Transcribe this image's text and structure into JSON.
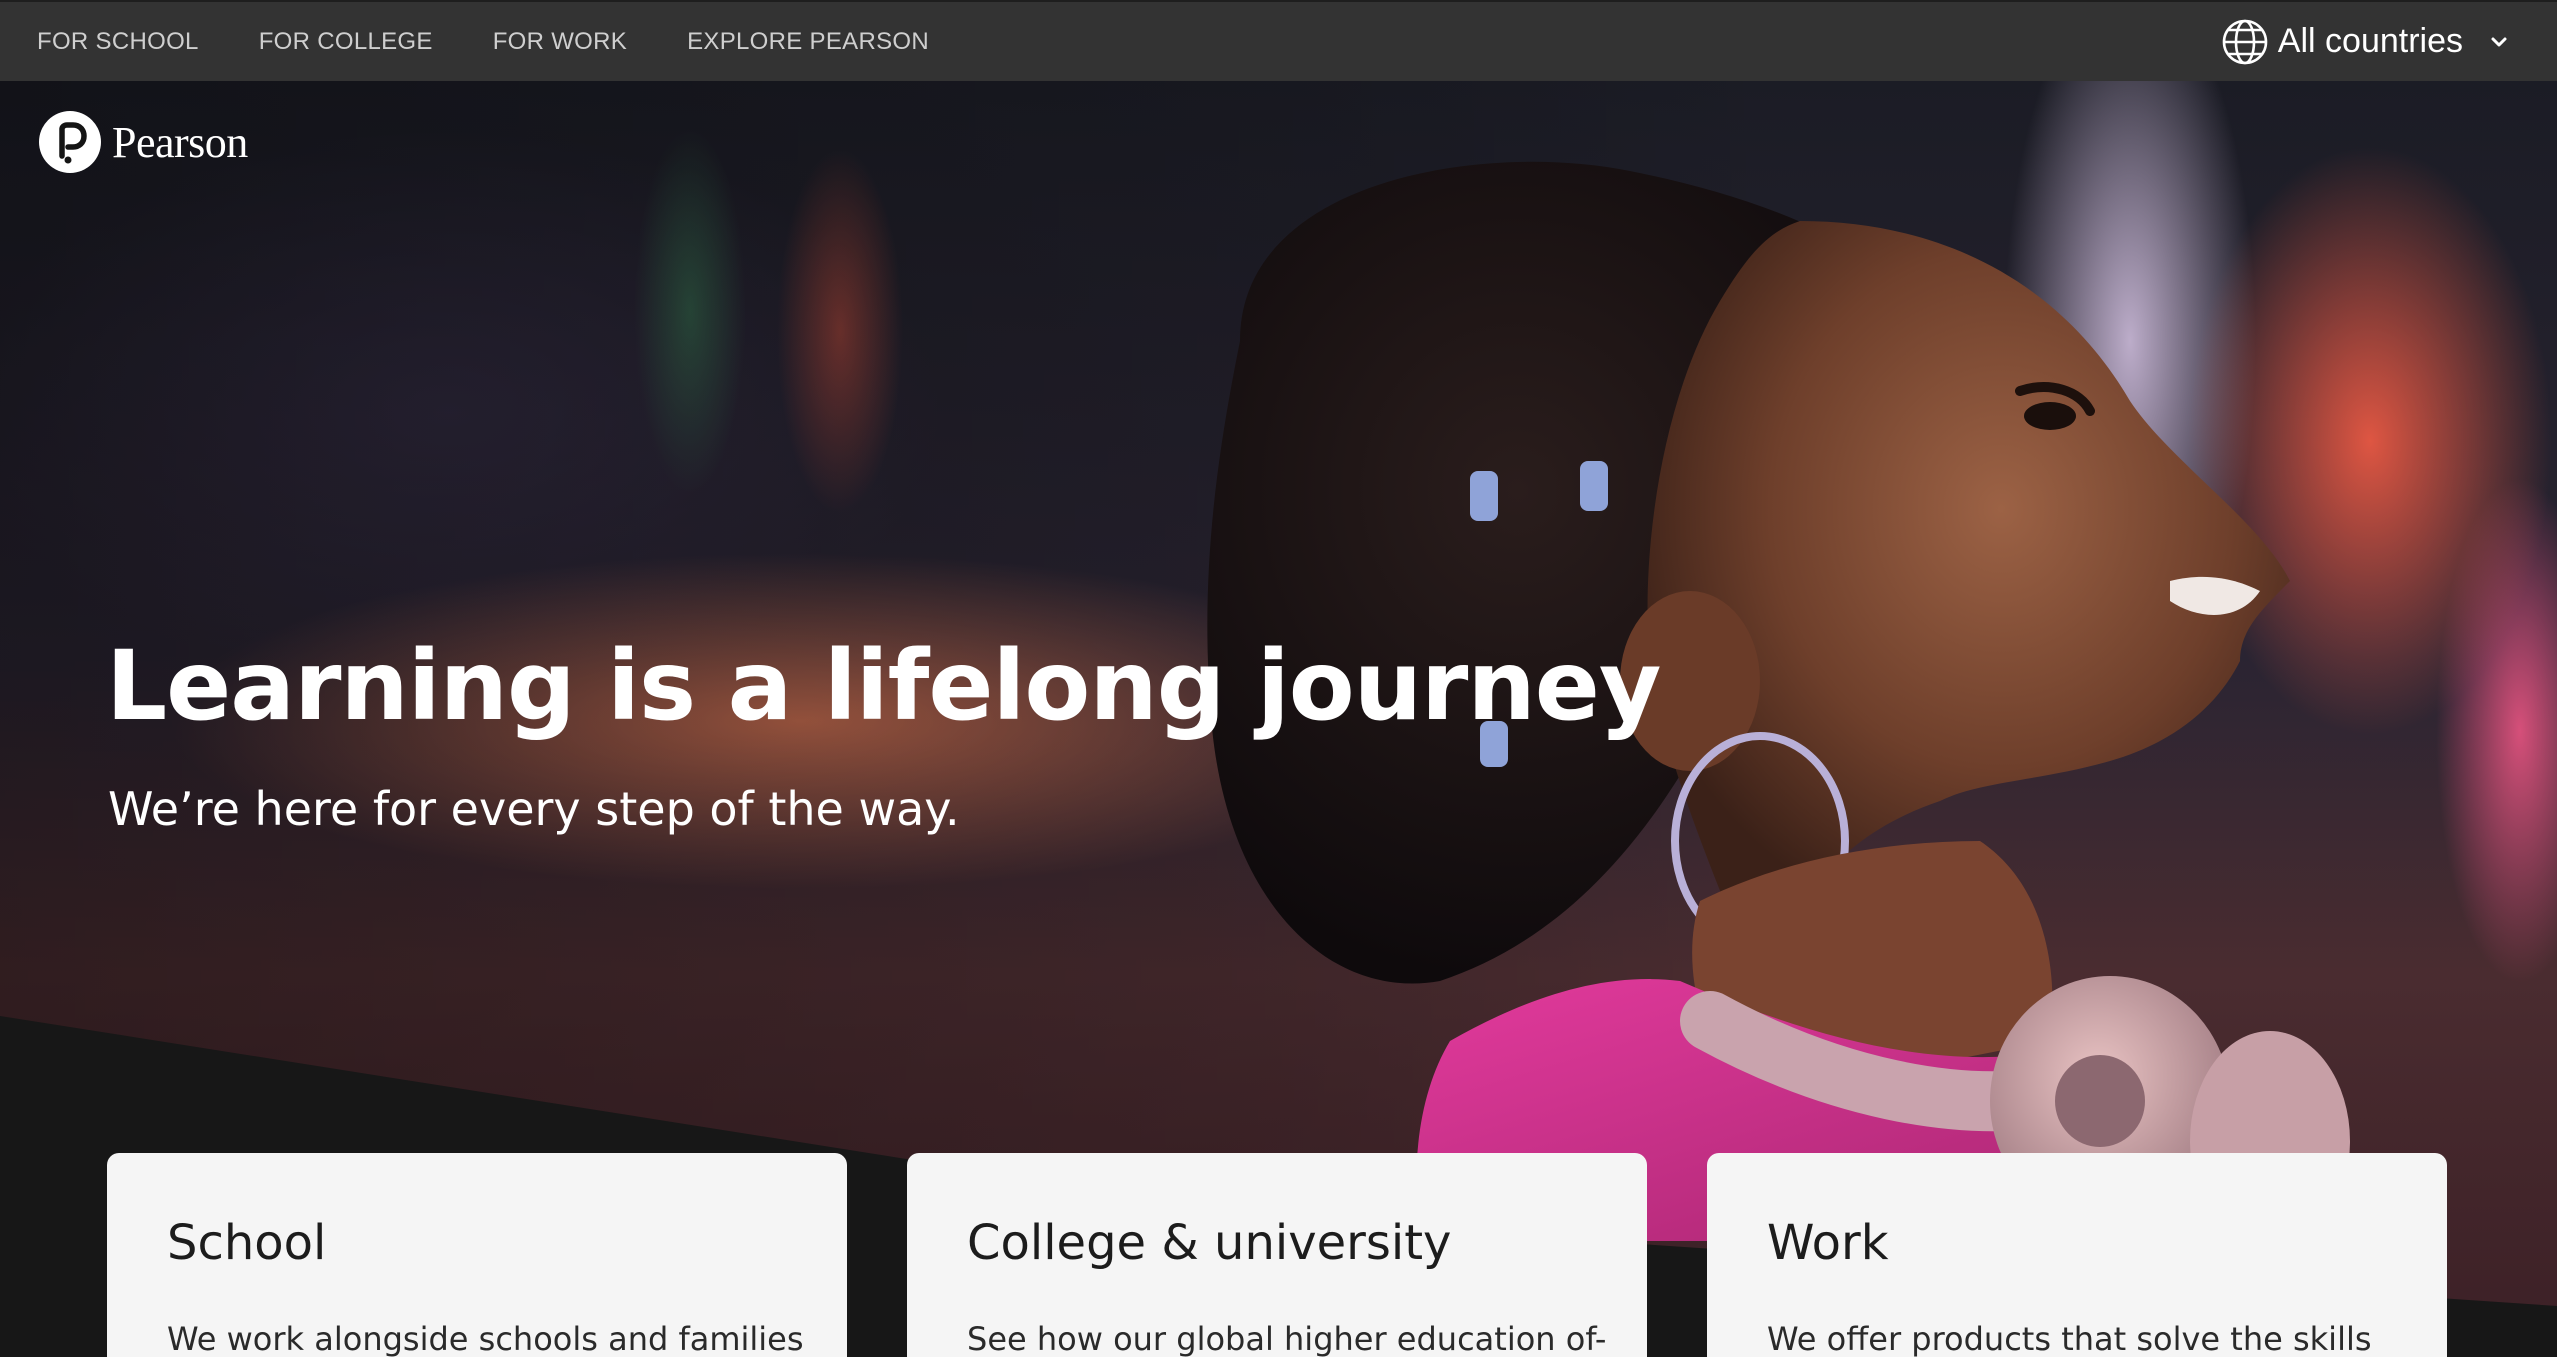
{
  "topnav": {
    "items": [
      {
        "label": "FOR SCHOOL"
      },
      {
        "label": "FOR COLLEGE"
      },
      {
        "label": "FOR WORK"
      },
      {
        "label": "EXPLORE PEARSON"
      }
    ],
    "country_selector": {
      "label": "All countries",
      "icon": "globe-icon",
      "chevron": "chevron-down-icon"
    }
  },
  "brand": {
    "name": "Pearson",
    "logo_icon": "pearson-p-logo"
  },
  "hero": {
    "title": "Learning is a lifelong journey",
    "subtitle": "We’re here for every step of the way."
  },
  "cards": [
    {
      "title": "School",
      "text": "We work alongside schools and families"
    },
    {
      "title": "College & university",
      "text": "See how our global higher education of-"
    },
    {
      "title": "Work",
      "text": "We offer products that solve the skills"
    }
  ],
  "colors": {
    "topbar": "#333333",
    "page_dark": "#171717",
    "card_bg": "#f5f5f5",
    "text_on_dark": "#ffffff"
  }
}
